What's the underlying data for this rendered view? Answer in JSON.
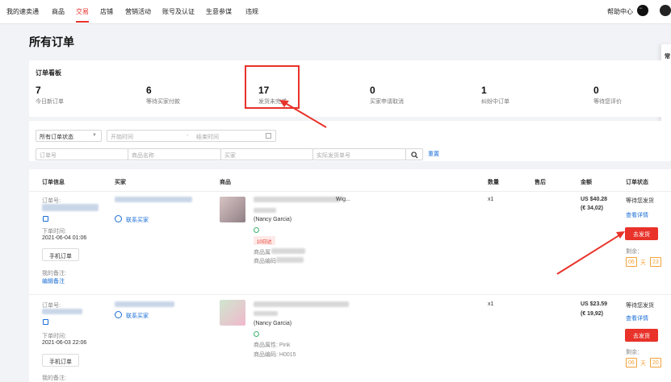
{
  "topnav": {
    "items": [
      "我的速卖通",
      "商品",
      "交易",
      "店铺",
      "营销活动",
      "账号及认证",
      "生意参谋",
      "违规"
    ],
    "active_index": 2,
    "help": "帮助中心"
  },
  "page_title": "所有订单",
  "side_panel": {
    "label": "常"
  },
  "board": {
    "title": "订单看板",
    "stats": [
      {
        "num": "7",
        "label": "今日新订单"
      },
      {
        "num": "6",
        "label": "等待买家付款"
      },
      {
        "num": "17",
        "label": "发货未完成"
      },
      {
        "num": "0",
        "label": "买家申请取消"
      },
      {
        "num": "1",
        "label": "纠纷中订单"
      },
      {
        "num": "0",
        "label": "等待您评价"
      }
    ]
  },
  "filter": {
    "status": "所有订单状态",
    "start": "开始时间",
    "sep": "-",
    "end": "结束时间",
    "order_no": "订单号",
    "product": "商品名称",
    "buyer": "买家",
    "tracking": "实际发货单号",
    "reset": "重置"
  },
  "table": {
    "headers": [
      "订单信息",
      "买家",
      "商品",
      "数量",
      "售后",
      "金额",
      "订单状态"
    ],
    "rows": [
      {
        "order_label": "订单号:",
        "time_label": "下单时间:",
        "time": "2021-06-04 01:06",
        "mobile": "手机订单",
        "note_label": "我的备注:",
        "edit_note": "编辑备注",
        "contact": "联系买家",
        "product_suffix": "Wig...",
        "buyer_name": "(Nancy Garcia)",
        "ship_tag": "10日达",
        "attr": "商品属",
        "code": "商品编码",
        "qty": "x1",
        "amount": "US $40.28",
        "amount_local": "(€ 34,02)",
        "status": "等待您发货",
        "detail": "查看详情",
        "ship_btn": "去发货",
        "remaining": "剩余：",
        "days": "06",
        "day_unit": "天",
        "hours": "23"
      },
      {
        "order_label": "订单号:",
        "time_label": "下单时间:",
        "time": "2021-06-03 22:06",
        "mobile": "手机订单",
        "note_label": "我的备注:",
        "contact": "联系买家",
        "buyer_name": "(Nancy Garcia)",
        "attr": "商品属性: Pink",
        "code": "商品编码: H0015",
        "qty": "x1",
        "amount": "US $23.59",
        "amount_local": "(€ 19,92)",
        "status": "等待您发货",
        "detail": "查看详情",
        "ship_btn": "去发货",
        "remaining": "剩余：",
        "days": "06",
        "day_unit": "天",
        "hours": "20"
      }
    ]
  },
  "colors": {
    "accent": "#e8322a",
    "link": "#1a6dd6",
    "timer": "#f4a13a"
  }
}
